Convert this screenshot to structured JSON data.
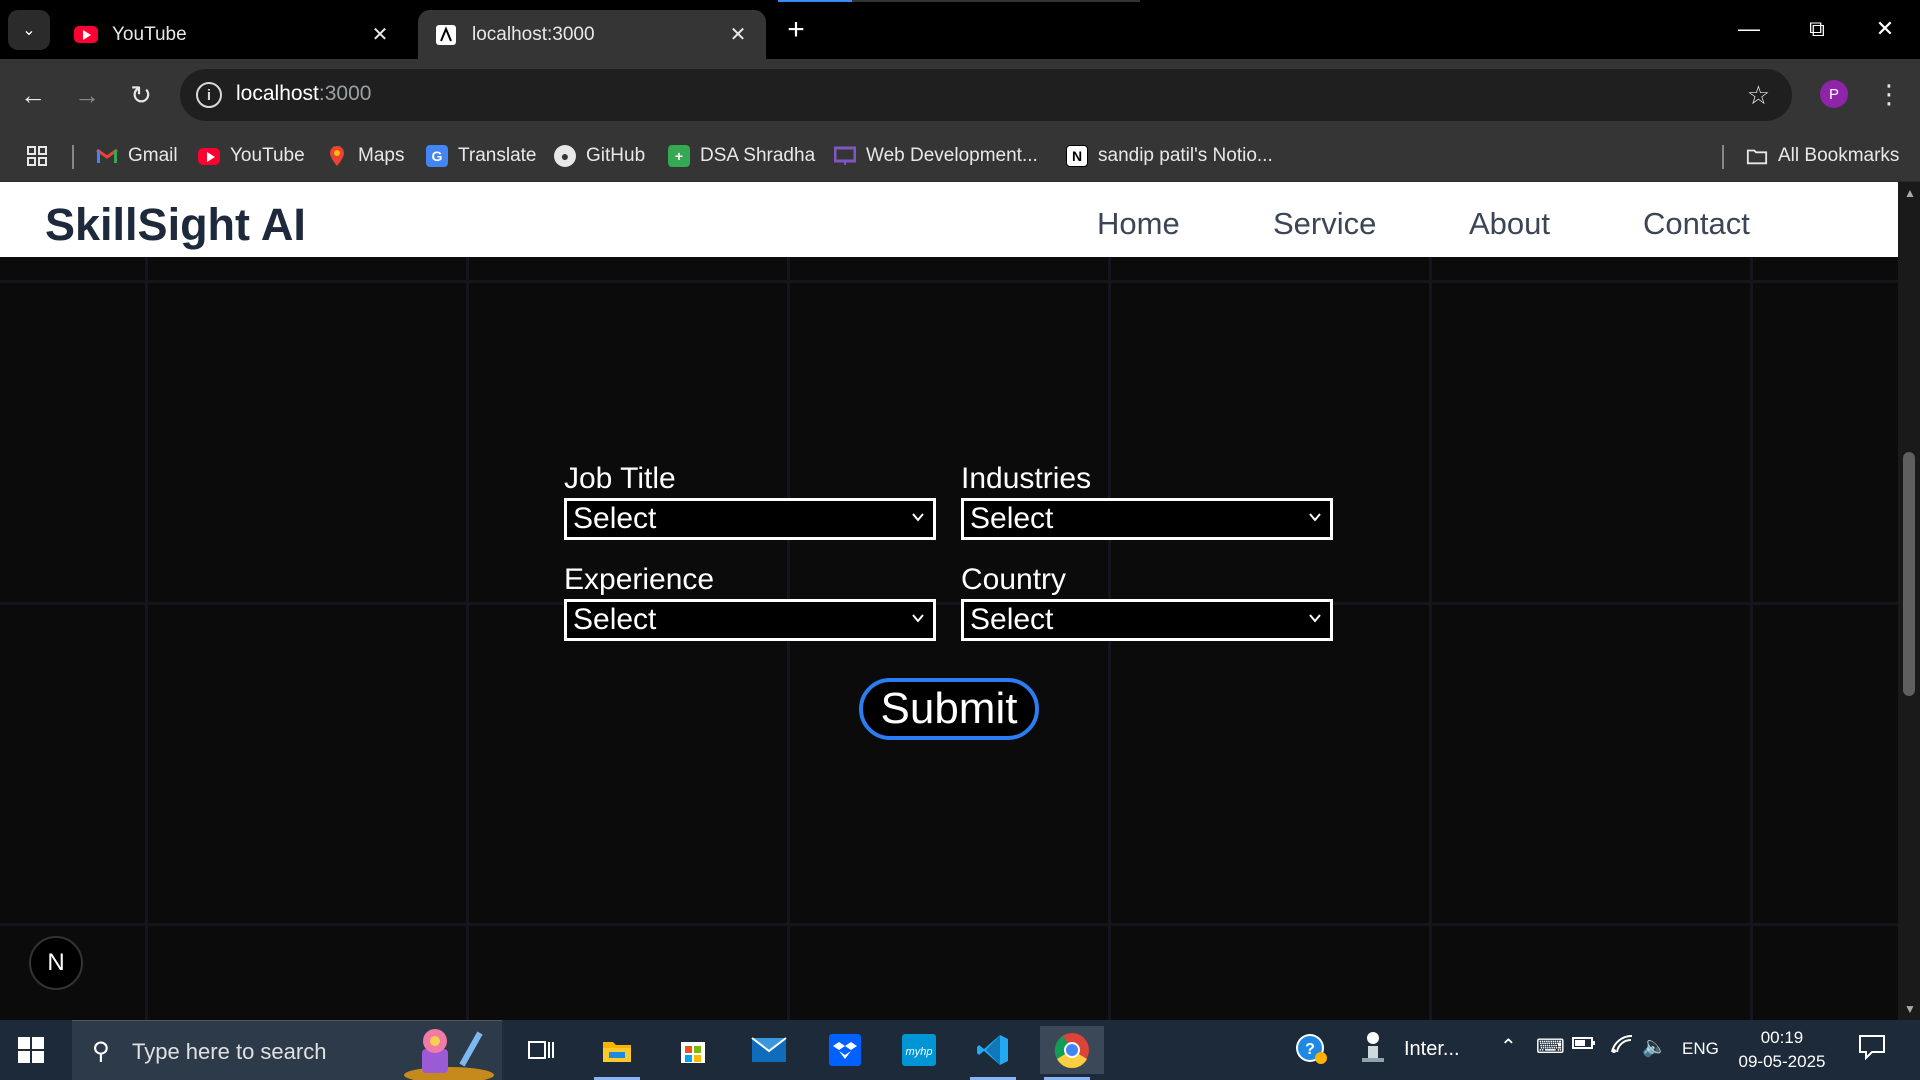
{
  "browser": {
    "tabs": [
      {
        "title": "YouTube",
        "active": false,
        "favicon": "youtube-icon"
      },
      {
        "title": "localhost:3000",
        "active": true,
        "favicon": "nextjs-page-icon"
      }
    ],
    "address": {
      "host": "localhost",
      "port": ":3000"
    },
    "profile_initial": "P",
    "bookmarks": [
      {
        "label": "Gmail",
        "icon": "gmail-icon"
      },
      {
        "label": "YouTube",
        "icon": "youtube-icon"
      },
      {
        "label": "Maps",
        "icon": "maps-icon"
      },
      {
        "label": "Translate",
        "icon": "translate-icon"
      },
      {
        "label": "GitHub",
        "icon": "github-icon"
      },
      {
        "label": "DSA Shradha",
        "icon": "sheets-icon"
      },
      {
        "label": "Web Development...",
        "icon": "slides-icon"
      },
      {
        "label": "sandip patil's Notio...",
        "icon": "notion-icon"
      }
    ],
    "all_bookmarks": "All Bookmarks"
  },
  "site": {
    "brand": "SkillSight AI",
    "nav": [
      "Home",
      "Service",
      "About",
      "Contact"
    ],
    "form": {
      "fields": [
        {
          "label": "Job Title",
          "value": "Select"
        },
        {
          "label": "Industries",
          "value": "Select"
        },
        {
          "label": "Experience",
          "value": "Select"
        },
        {
          "label": "Country",
          "value": "Select"
        }
      ],
      "submit": "Submit"
    },
    "dev_badge": "N"
  },
  "taskbar": {
    "search_placeholder": "Type here to search",
    "tray_app_label": "Inter...",
    "language": "ENG",
    "time": "00:19",
    "date": "09-05-2025"
  },
  "colors": {
    "page_bg": "#0b0b0c",
    "navbar_bg": "#ffffff",
    "brand_text": "#1e2a3b",
    "submit_border": "#2a7df2",
    "browser_chrome": "#353535",
    "taskbar_bg": "#1c2a3a"
  }
}
